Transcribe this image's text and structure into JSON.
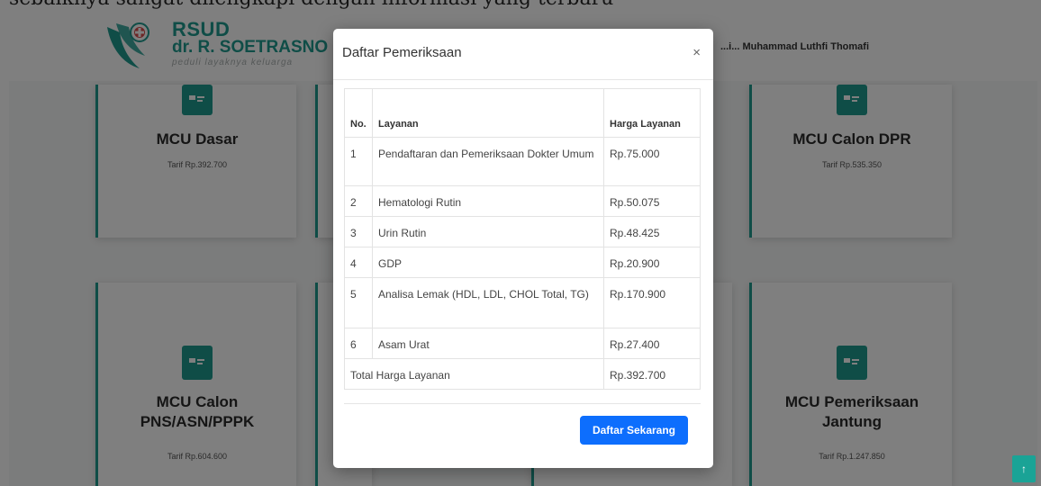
{
  "header": {
    "top_cropped_text": "sebaiknya sangat dilengkapi dengan informasi yang terbaru",
    "logo": {
      "line1": "RSUD",
      "line2": "dr. R. SOETRASNO",
      "tagline": "peduli layaknya keluarga"
    },
    "user_name": "...i... Muhammad Luthfi Thomafi"
  },
  "cards": [
    {
      "title": "MCU Dasar",
      "tarif": "Tarif Rp.392.700"
    },
    {
      "title": "MCU Calon DPR",
      "tarif": "Tarif Rp.535.350"
    },
    {
      "title": "MCU Calon PNS/ASN/PPPK",
      "tarif": "Tarif Rp.604.600"
    },
    {
      "title": "MCU Pemeriksaan Jantung",
      "tarif": "Tarif Rp.1.247.850"
    }
  ],
  "modal": {
    "title": "Daftar Pemeriksaan",
    "close": "×",
    "table": {
      "headers": {
        "no": "No.",
        "layanan": "Layanan",
        "harga": "Harga Layanan"
      },
      "rows": [
        {
          "no": "1",
          "layanan": "Pendaftaran dan Pemeriksaan Dokter Umum",
          "harga": "Rp.75.000"
        },
        {
          "no": "2",
          "layanan": "Hematologi Rutin",
          "harga": "Rp.50.075"
        },
        {
          "no": "3",
          "layanan": "Urin Rutin",
          "harga": "Rp.48.425"
        },
        {
          "no": "4",
          "layanan": "GDP",
          "harga": "Rp.20.900"
        },
        {
          "no": "5",
          "layanan": "Analisa Lemak (HDL, LDL, CHOL Total, TG)",
          "harga": "Rp.170.900"
        },
        {
          "no": "6",
          "layanan": "Asam Urat",
          "harga": "Rp.27.400"
        }
      ],
      "total": {
        "label": "Total Harga Layanan",
        "value": "Rp.392.700"
      }
    },
    "button_label": "Daftar Sekarang"
  },
  "scroll_top": "↑",
  "colors": {
    "brand": "#1f9b8f",
    "button": "#0d6efd"
  }
}
